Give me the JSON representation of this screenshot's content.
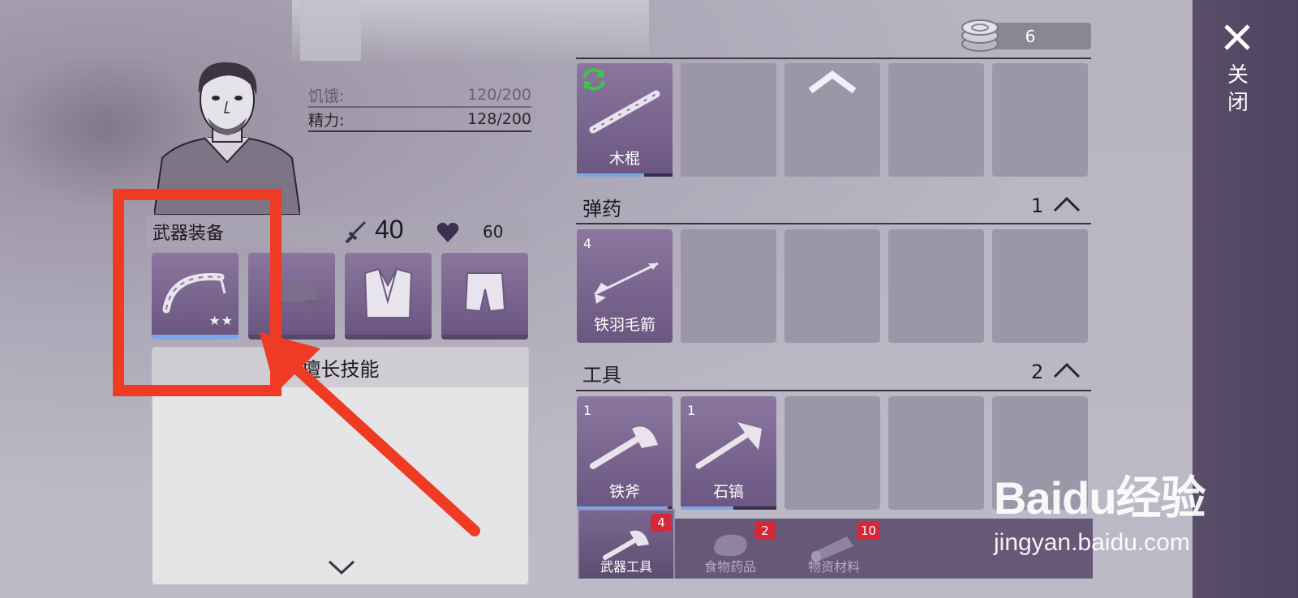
{
  "character": {
    "stats": [
      {
        "label": "饥饿:",
        "value": "120/200"
      },
      {
        "label": "精力:",
        "value": "128/200"
      }
    ]
  },
  "equipment": {
    "title": "武器装备",
    "attack": "40",
    "hp": "60",
    "slots": [
      "bow-icon",
      "cap-icon",
      "vest-icon",
      "shorts-icon"
    ],
    "weapon_stars": "★★"
  },
  "skills": {
    "title": "擅长技能"
  },
  "currency": {
    "amount": "6"
  },
  "inventory": {
    "weapons": {
      "items": [
        {
          "name": "木棍",
          "durability": 0.7
        }
      ]
    },
    "ammo": {
      "title": "弹药",
      "count": "1",
      "items": [
        {
          "name": "铁羽毛箭",
          "qty": "4"
        }
      ]
    },
    "tools": {
      "title": "工具",
      "count": "2",
      "items": [
        {
          "name": "铁斧",
          "qty": "1",
          "durability": 0.95
        },
        {
          "name": "石镐",
          "qty": "1",
          "durability": 0.55
        }
      ]
    }
  },
  "tabs": [
    {
      "label": "武器工具",
      "badge": "4",
      "active": true
    },
    {
      "label": "食物药品",
      "badge": "2",
      "active": false
    },
    {
      "label": "物资材料",
      "badge": "10",
      "active": false
    }
  ],
  "close_label": "关闭",
  "watermark": {
    "logo": "Baidu经验",
    "url": "jingyan.baidu.com"
  },
  "colors": {
    "annotation": "#ef3b23",
    "slot_purple": "#7a6790",
    "durability_blue": "#7aa6e8",
    "badge_red": "#d4283a"
  }
}
